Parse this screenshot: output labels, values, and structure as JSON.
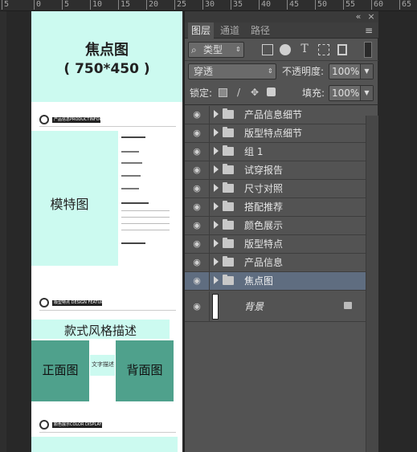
{
  "ruler": {
    "ticks": [
      "5",
      "0",
      "5",
      "10",
      "15",
      "20",
      "25",
      "30",
      "35",
      "40",
      "45",
      "50",
      "55",
      "60",
      "65"
    ]
  },
  "document": {
    "focus_title": "焦点图",
    "focus_size": "( 750*450 )",
    "model_label": "模特图",
    "style_desc": "款式风格描述",
    "front_label": "正面图",
    "text_desc": "文字描述",
    "back_label": "背面图",
    "header1": "产品信息PRODUCTINFORMATION",
    "header2": "版型特点 DESIGN FEATURES",
    "header3": "颜色展示COLOR DISPLAY"
  },
  "panel": {
    "collapse_icon": "«",
    "close_icon": "×",
    "menu_icon": "≡",
    "tabs": [
      {
        "label": "图层",
        "active": true
      },
      {
        "label": "通道",
        "active": false
      },
      {
        "label": "路径",
        "active": false
      }
    ],
    "filter_label": "类型",
    "filter_icons": [
      "image-filter-icon",
      "adjust-filter-icon",
      "type-filter-icon",
      "shape-filter-icon",
      "smart-filter-icon"
    ],
    "blend_mode": "穿透",
    "opacity_label": "不透明度:",
    "opacity_value": "100%",
    "lock_label": "锁定:",
    "fill_label": "填充:",
    "fill_value": "100%",
    "layers": [
      {
        "name": "产品信息细节",
        "selected": false
      },
      {
        "name": "版型特点细节",
        "selected": false
      },
      {
        "name": "组 1",
        "selected": false
      },
      {
        "name": "试穿报告",
        "selected": false
      },
      {
        "name": "尺寸对照",
        "selected": false
      },
      {
        "name": "搭配推荐",
        "selected": false
      },
      {
        "name": "颜色展示",
        "selected": false
      },
      {
        "name": "版型特点",
        "selected": false
      },
      {
        "name": "产品信息",
        "selected": false
      },
      {
        "name": "焦点图",
        "selected": true
      }
    ],
    "background_layer": "背景"
  }
}
